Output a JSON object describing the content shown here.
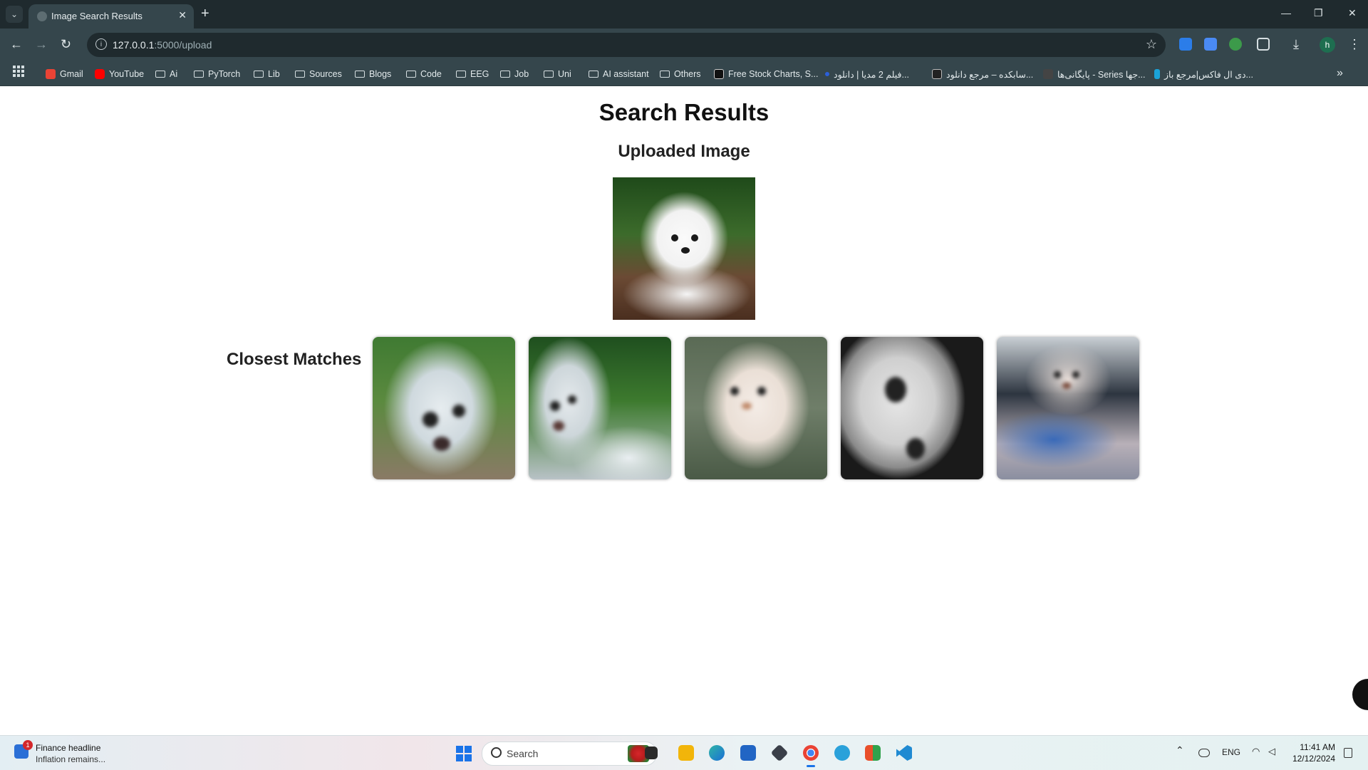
{
  "browser": {
    "tab_title": "Image Search Results",
    "url_host": "127.0.0.1",
    "url_path": ":5000/upload",
    "bookmarks": [
      {
        "label": "Gmail",
        "icon": "gmail-icon"
      },
      {
        "label": "YouTube",
        "icon": "youtube-icon"
      },
      {
        "label": "Ai",
        "icon": "folder-icon"
      },
      {
        "label": "PyTorch",
        "icon": "folder-icon"
      },
      {
        "label": "Lib",
        "icon": "folder-icon"
      },
      {
        "label": "Sources",
        "icon": "folder-icon"
      },
      {
        "label": "Blogs",
        "icon": "folder-icon"
      },
      {
        "label": "Code",
        "icon": "folder-icon"
      },
      {
        "label": "EEG",
        "icon": "folder-icon"
      },
      {
        "label": "Job",
        "icon": "folder-icon"
      },
      {
        "label": "Uni",
        "icon": "folder-icon"
      },
      {
        "label": "AI assistant",
        "icon": "folder-icon"
      },
      {
        "label": "Others",
        "icon": "folder-icon"
      },
      {
        "label": "Free Stock Charts, S...",
        "icon": "tradingview-icon"
      },
      {
        "label": "فیلم 2 مدیا | دانلود...",
        "icon": "site-icon"
      },
      {
        "label": "سابکده – مرجع دانلود...",
        "icon": "site-icon"
      },
      {
        "label": "پایگانی‌ها - Series جها...",
        "icon": "site-icon"
      },
      {
        "label": "دی ال فاکس|مرجع باز...",
        "icon": "site-icon"
      }
    ]
  },
  "page": {
    "title": "Search Results",
    "uploaded_heading": "Uploaded Image",
    "matches_heading": "Closest Matches",
    "match_count": 5
  },
  "taskbar": {
    "widget_title": "Finance headline",
    "widget_subtitle": "Inflation remains...",
    "widget_badge": "1",
    "search_placeholder": "Search",
    "language": "ENG",
    "time": "11:41 AM",
    "date": "12/12/2024"
  }
}
